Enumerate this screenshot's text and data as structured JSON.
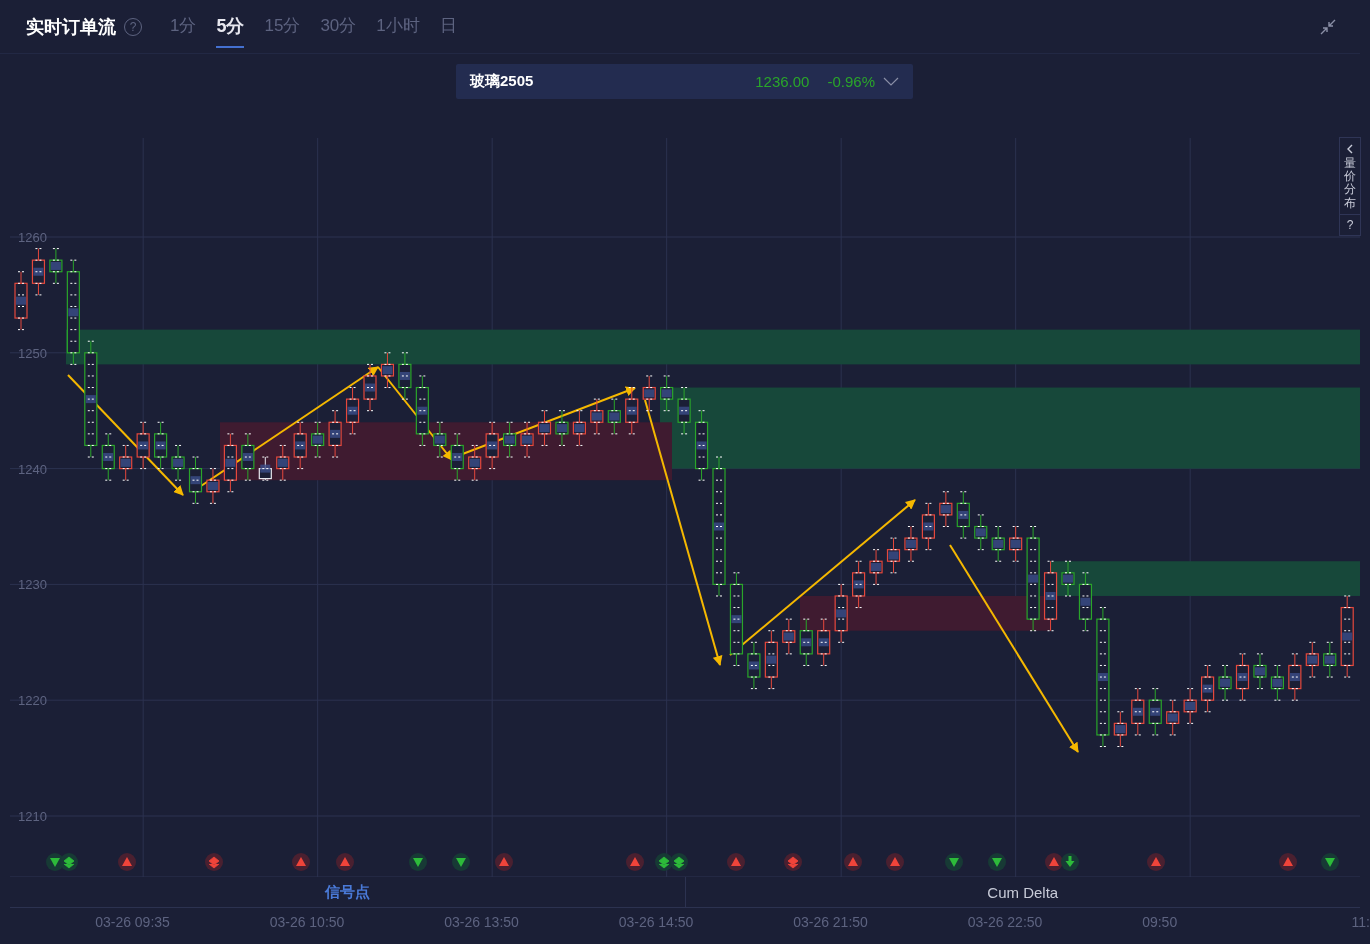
{
  "header": {
    "title": "实时订单流",
    "help": "?",
    "timeframes": [
      {
        "label": "1分",
        "selected": false
      },
      {
        "label": "5分",
        "selected": true
      },
      {
        "label": "15分",
        "selected": false
      },
      {
        "label": "30分",
        "selected": false
      },
      {
        "label": "1小时",
        "selected": false
      },
      {
        "label": "日",
        "selected": false
      }
    ]
  },
  "symbol": {
    "name": "玻璃2505",
    "price": "1236.00",
    "change": "-0.96%"
  },
  "side_panel": {
    "label": "量价分布",
    "help": "?"
  },
  "chart_data": {
    "type": "candlestick",
    "grid": true,
    "ylim": [
      1210,
      1260
    ],
    "yticks": [
      1260,
      1250,
      1240,
      1230,
      1220,
      1210
    ],
    "ohlc": [
      [
        1253,
        1257,
        1252,
        1256
      ],
      [
        1256,
        1259,
        1255,
        1258
      ],
      [
        1258,
        1259,
        1256,
        1257
      ],
      [
        1257,
        1258,
        1249,
        1250
      ],
      [
        1250,
        1251,
        1241,
        1242
      ],
      [
        1242,
        1243,
        1239,
        1240
      ],
      [
        1240,
        1242,
        1239,
        1241
      ],
      [
        1241,
        1244,
        1240,
        1243
      ],
      [
        1243,
        1244,
        1240,
        1241
      ],
      [
        1241,
        1242,
        1239,
        1240
      ],
      [
        1240,
        1241,
        1237,
        1238
      ],
      [
        1238,
        1240,
        1237,
        1239
      ],
      [
        1239,
        1243,
        1238,
        1242
      ],
      [
        1242,
        1243,
        1239,
        1240
      ],
      [
        1240,
        1241,
        1239,
        1240
      ],
      [
        1240,
        1242,
        1239,
        1241
      ],
      [
        1241,
        1244,
        1240,
        1243
      ],
      [
        1243,
        1244,
        1241,
        1242
      ],
      [
        1242,
        1245,
        1241,
        1244
      ],
      [
        1244,
        1247,
        1243,
        1246
      ],
      [
        1246,
        1249,
        1245,
        1248
      ],
      [
        1248,
        1250,
        1247,
        1249
      ],
      [
        1249,
        1250,
        1246,
        1247
      ],
      [
        1247,
        1248,
        1242,
        1243
      ],
      [
        1243,
        1244,
        1241,
        1242
      ],
      [
        1242,
        1243,
        1239,
        1240
      ],
      [
        1240,
        1242,
        1239,
        1241
      ],
      [
        1241,
        1244,
        1240,
        1243
      ],
      [
        1243,
        1244,
        1241,
        1242
      ],
      [
        1242,
        1244,
        1241,
        1243
      ],
      [
        1243,
        1245,
        1242,
        1244
      ],
      [
        1244,
        1245,
        1242,
        1243
      ],
      [
        1243,
        1245,
        1242,
        1244
      ],
      [
        1244,
        1246,
        1243,
        1245
      ],
      [
        1245,
        1246,
        1243,
        1244
      ],
      [
        1244,
        1247,
        1243,
        1246
      ],
      [
        1246,
        1248,
        1245,
        1247
      ],
      [
        1247,
        1248,
        1245,
        1246
      ],
      [
        1246,
        1247,
        1243,
        1244
      ],
      [
        1244,
        1245,
        1239,
        1240
      ],
      [
        1240,
        1241,
        1229,
        1230
      ],
      [
        1230,
        1231,
        1223,
        1224
      ],
      [
        1224,
        1225,
        1221,
        1222
      ],
      [
        1222,
        1226,
        1221,
        1225
      ],
      [
        1225,
        1227,
        1224,
        1226
      ],
      [
        1226,
        1227,
        1223,
        1224
      ],
      [
        1224,
        1227,
        1223,
        1226
      ],
      [
        1226,
        1230,
        1225,
        1229
      ],
      [
        1229,
        1232,
        1228,
        1231
      ],
      [
        1231,
        1233,
        1230,
        1232
      ],
      [
        1232,
        1234,
        1231,
        1233
      ],
      [
        1233,
        1235,
        1232,
        1234
      ],
      [
        1234,
        1237,
        1233,
        1236
      ],
      [
        1236,
        1238,
        1235,
        1237
      ],
      [
        1237,
        1238,
        1234,
        1235
      ],
      [
        1235,
        1236,
        1233,
        1234
      ],
      [
        1234,
        1235,
        1232,
        1233
      ],
      [
        1233,
        1235,
        1232,
        1234
      ],
      [
        1234,
        1235,
        1226,
        1227
      ],
      [
        1227,
        1232,
        1226,
        1231
      ],
      [
        1231,
        1232,
        1229,
        1230
      ],
      [
        1230,
        1231,
        1226,
        1227
      ],
      [
        1227,
        1228,
        1216,
        1217
      ],
      [
        1217,
        1219,
        1216,
        1218
      ],
      [
        1218,
        1221,
        1217,
        1220
      ],
      [
        1220,
        1221,
        1217,
        1218
      ],
      [
        1218,
        1220,
        1217,
        1219
      ],
      [
        1219,
        1221,
        1218,
        1220
      ],
      [
        1220,
        1223,
        1219,
        1222
      ],
      [
        1222,
        1223,
        1220,
        1221
      ],
      [
        1221,
        1224,
        1220,
        1223
      ],
      [
        1223,
        1224,
        1221,
        1222
      ],
      [
        1222,
        1223,
        1220,
        1221
      ],
      [
        1221,
        1224,
        1220,
        1223
      ],
      [
        1223,
        1225,
        1222,
        1224
      ],
      [
        1224,
        1225,
        1222,
        1223
      ],
      [
        1223,
        1229,
        1222,
        1228
      ]
    ]
  },
  "panels": [
    {
      "label": "信号点",
      "selected": true
    },
    {
      "label": "Cum Delta",
      "selected": false
    }
  ],
  "x_axis": [
    "03-26 09:35",
    "03-26 10:50",
    "03-26 13:50",
    "03-26 14:50",
    "03-26 21:50",
    "03-26 22:50",
    "09:50",
    "11:"
  ]
}
